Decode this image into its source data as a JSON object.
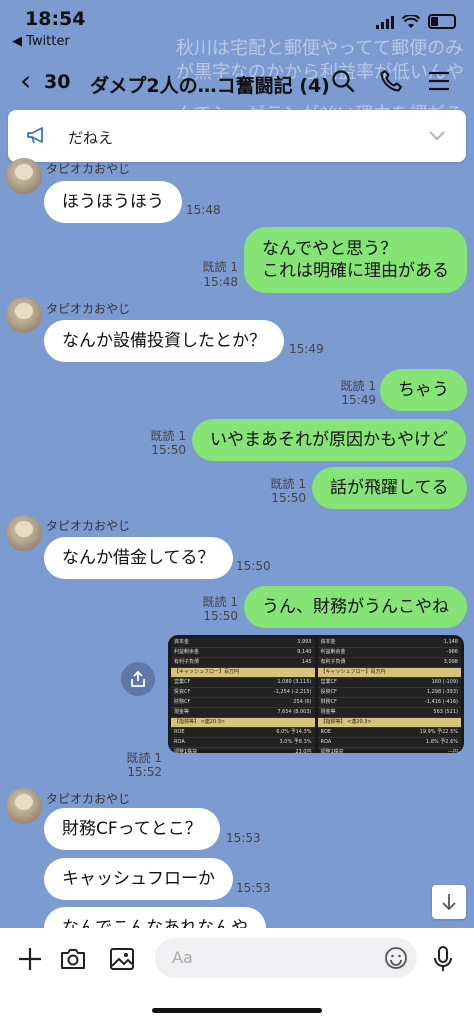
{
  "status": {
    "time": "18:54",
    "back_app": "◀ Twitter"
  },
  "header": {
    "back_count": "30",
    "title": "ダメプ2人の…コ奮闘記 (4)"
  },
  "ghost": {
    "line1": "秋川は宅配と郵便やってて郵便のみ",
    "line2": "が黒字なのかから利益率が低いんや",
    "line3": "んでシーゲランが凶い理由を謂ぢる"
  },
  "notice": {
    "text": "だねえ"
  },
  "messages": [
    {
      "side": "left",
      "sender": "タピオカおやじ",
      "text": "ほうほうほう",
      "time": "15:48"
    },
    {
      "side": "right",
      "read": "既読 1",
      "time": "15:48",
      "text": "なんでやと思う？\nこれは明確に理由がある"
    },
    {
      "side": "left",
      "sender": "タピオカおやじ",
      "text": "なんか設備投資したとか？",
      "time": "15:49"
    },
    {
      "side": "right",
      "read": "既読 1",
      "time": "15:49",
      "text": "ちゃう"
    },
    {
      "side": "right",
      "read": "既読 1",
      "time": "15:50",
      "text": "いやまあそれが原因かもやけど"
    },
    {
      "side": "right",
      "read": "既読 1",
      "time": "15:50",
      "text": "話が飛躍してる"
    },
    {
      "side": "left",
      "sender": "タピオカおやじ",
      "text": "なんか借金してる？",
      "time": "15:50"
    },
    {
      "side": "right",
      "read": "既読 1",
      "time": "15:50",
      "text": "うん、財務がうんこやね"
    },
    {
      "side": "right-image",
      "read": "既読 1",
      "time": "15:52"
    },
    {
      "side": "left",
      "sender": "タピオカおやじ",
      "text": "財務CFってとこ？",
      "time": "15:53"
    },
    {
      "side": "left",
      "text": "キャッシュフローか",
      "time": "15:53"
    },
    {
      "side": "left",
      "text": "なんでこんなあれなんや"
    }
  ],
  "image": {
    "col1": [
      [
        "資本金",
        "3,993"
      ],
      [
        "利益剰余金",
        "9,140"
      ],
      [
        "有利子負債",
        "145"
      ],
      [
        "【キャッシュフロー】百万円",
        ""
      ],
      [
        "営業CF",
        "1,080 (3,115)"
      ],
      [
        "投資CF",
        "-1,254 (-2,215)"
      ],
      [
        "財務CF",
        "254 (6)"
      ],
      [
        "現金等",
        "7,654 (8,003)"
      ],
      [
        "【指標等】 <連20.3>",
        ""
      ],
      [
        "ROE",
        "6.0% 予14.3%"
      ],
      [
        "ROA",
        "3.0% 予8.3%"
      ],
      [
        "調整1株益",
        "23.0円"
      ],
      [
        "最高純益(19.3)",
        "2,397"
      ]
    ],
    "col2": [
      [
        "資本金",
        "1,148"
      ],
      [
        "利益剰余金",
        "-986"
      ],
      [
        "有利子負債",
        "3,098"
      ],
      [
        "【キャッシュフロー】百万円",
        ""
      ],
      [
        "営業CF",
        "160 (-109)"
      ],
      [
        "投資CF",
        "1,298 (-393)"
      ],
      [
        "財務CF",
        "-1,416 (-416)"
      ],
      [
        "現金等",
        "563 (521)"
      ],
      [
        "【指標等】 <連20.3>",
        ""
      ],
      [
        "ROE",
        "19.9% 予22.5%"
      ],
      [
        "ROA",
        "1.8% 予2.6%"
      ],
      [
        "調整1株益",
        "—円"
      ],
      [
        "最高純益(20.3)",
        "341"
      ]
    ]
  },
  "input": {
    "placeholder": "Aa"
  }
}
